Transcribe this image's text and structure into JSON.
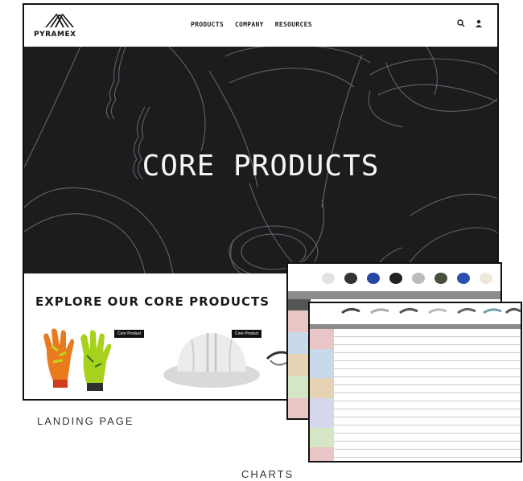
{
  "nav": {
    "logo_text": "PYRAMEX",
    "menu": [
      "PRODUCTS",
      "COMPANY",
      "RESOURCES"
    ],
    "icons": [
      "search-icon",
      "user-icon"
    ]
  },
  "hero": {
    "title": "CORE PRODUCTS"
  },
  "explore": {
    "title": "EXPLORE OUR CORE PRODUCTS",
    "badges": [
      "Core Product",
      "Core Product"
    ]
  },
  "captions": {
    "landing": "LANDING PAGE",
    "charts": "CHARTS"
  },
  "colors": {
    "hero_bg": "#1b1c1e",
    "table_header": "#8c8c8c",
    "row_pink": "#e9c6c6",
    "row_blue": "#c8d9ea",
    "row_tan": "#e6d3b3"
  }
}
